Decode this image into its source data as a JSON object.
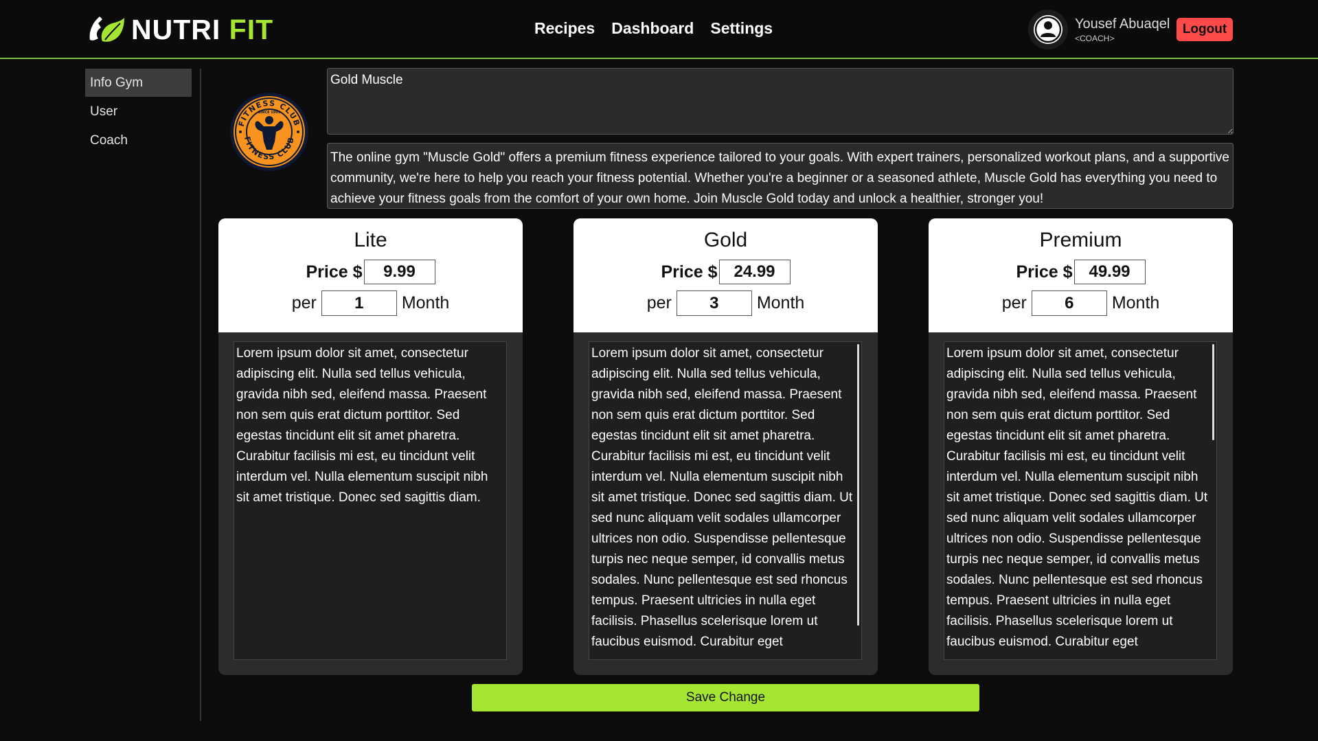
{
  "brand": {
    "name_white": "NUTRI",
    "name_green": "FIT",
    "accent": "#a5e633"
  },
  "nav": {
    "items": [
      "Recipes",
      "Dashboard",
      "Settings"
    ]
  },
  "user": {
    "name": "Yousef Abuaqel",
    "role": "<COACH>",
    "logout_label": "Logout"
  },
  "sidebar": {
    "items": [
      {
        "label": "Info Gym"
      },
      {
        "label": "User"
      },
      {
        "label": "Coach"
      }
    ]
  },
  "gym": {
    "name": "Gold Muscle",
    "description": "The online gym \"Muscle Gold\" offers a premium fitness experience tailored to your goals. With expert trainers, personalized workout plans, and a supportive community, we're here to help you reach your fitness potential. Whether you're a beginner or a seasoned athlete, Muscle Gold has everything you need to achieve your fitness goals from the comfort of your own home. Join Muscle Gold today and unlock a healthier, stronger you!",
    "logo_text": "FITNESS CLUB",
    "logo_since": "SINCE 1999"
  },
  "plan_labels": {
    "price": "Price $",
    "per": "per",
    "month": "Month"
  },
  "plans": [
    {
      "title": "Lite",
      "price": "9.99",
      "months": "1",
      "description": "Lorem ipsum dolor sit amet, consectetur adipiscing elit. Nulla sed tellus vehicula, gravida nibh sed, eleifend massa. Praesent non sem quis erat dictum porttitor. Sed egestas tincidunt elit sit amet pharetra. Curabitur facilisis mi est, eu tincidunt velit interdum vel. Nulla elementum suscipit nibh sit amet tristique. Donec sed sagittis diam."
    },
    {
      "title": "Gold",
      "price": "24.99",
      "months": "3",
      "description": "Lorem ipsum dolor sit amet, consectetur adipiscing elit. Nulla sed tellus vehicula, gravida nibh sed, eleifend massa. Praesent non sem quis erat dictum porttitor. Sed egestas tincidunt elit sit amet pharetra. Curabitur facilisis mi est, eu tincidunt velit interdum vel. Nulla elementum suscipit nibh sit amet tristique. Donec sed sagittis diam. Ut sed nunc aliquam velit sodales ullamcorper ultrices non odio. Suspendisse pellentesque turpis nec neque semper, id convallis metus sodales. Nunc pellentesque est sed rhoncus tempus. Praesent ultricies in nulla eget facilisis. Phasellus scelerisque lorem ut faucibus euismod. Curabitur eget"
    },
    {
      "title": "Premium",
      "price": "49.99",
      "months": "6",
      "description": "Lorem ipsum dolor sit amet, consectetur adipiscing elit. Nulla sed tellus vehicula, gravida nibh sed, eleifend massa. Praesent non sem quis erat dictum porttitor. Sed egestas tincidunt elit sit amet pharetra. Curabitur facilisis mi est, eu tincidunt velit interdum vel. Nulla elementum suscipit nibh sit amet tristique. Donec sed sagittis diam. Ut sed nunc aliquam velit sodales ullamcorper ultrices non odio. Suspendisse pellentesque turpis nec neque semper, id convallis metus sodales. Nunc pellentesque est sed rhoncus tempus. Praesent ultricies in nulla eget facilisis. Phasellus scelerisque lorem ut faucibus euismod. Curabitur eget"
    }
  ],
  "save_label": "Save Change"
}
